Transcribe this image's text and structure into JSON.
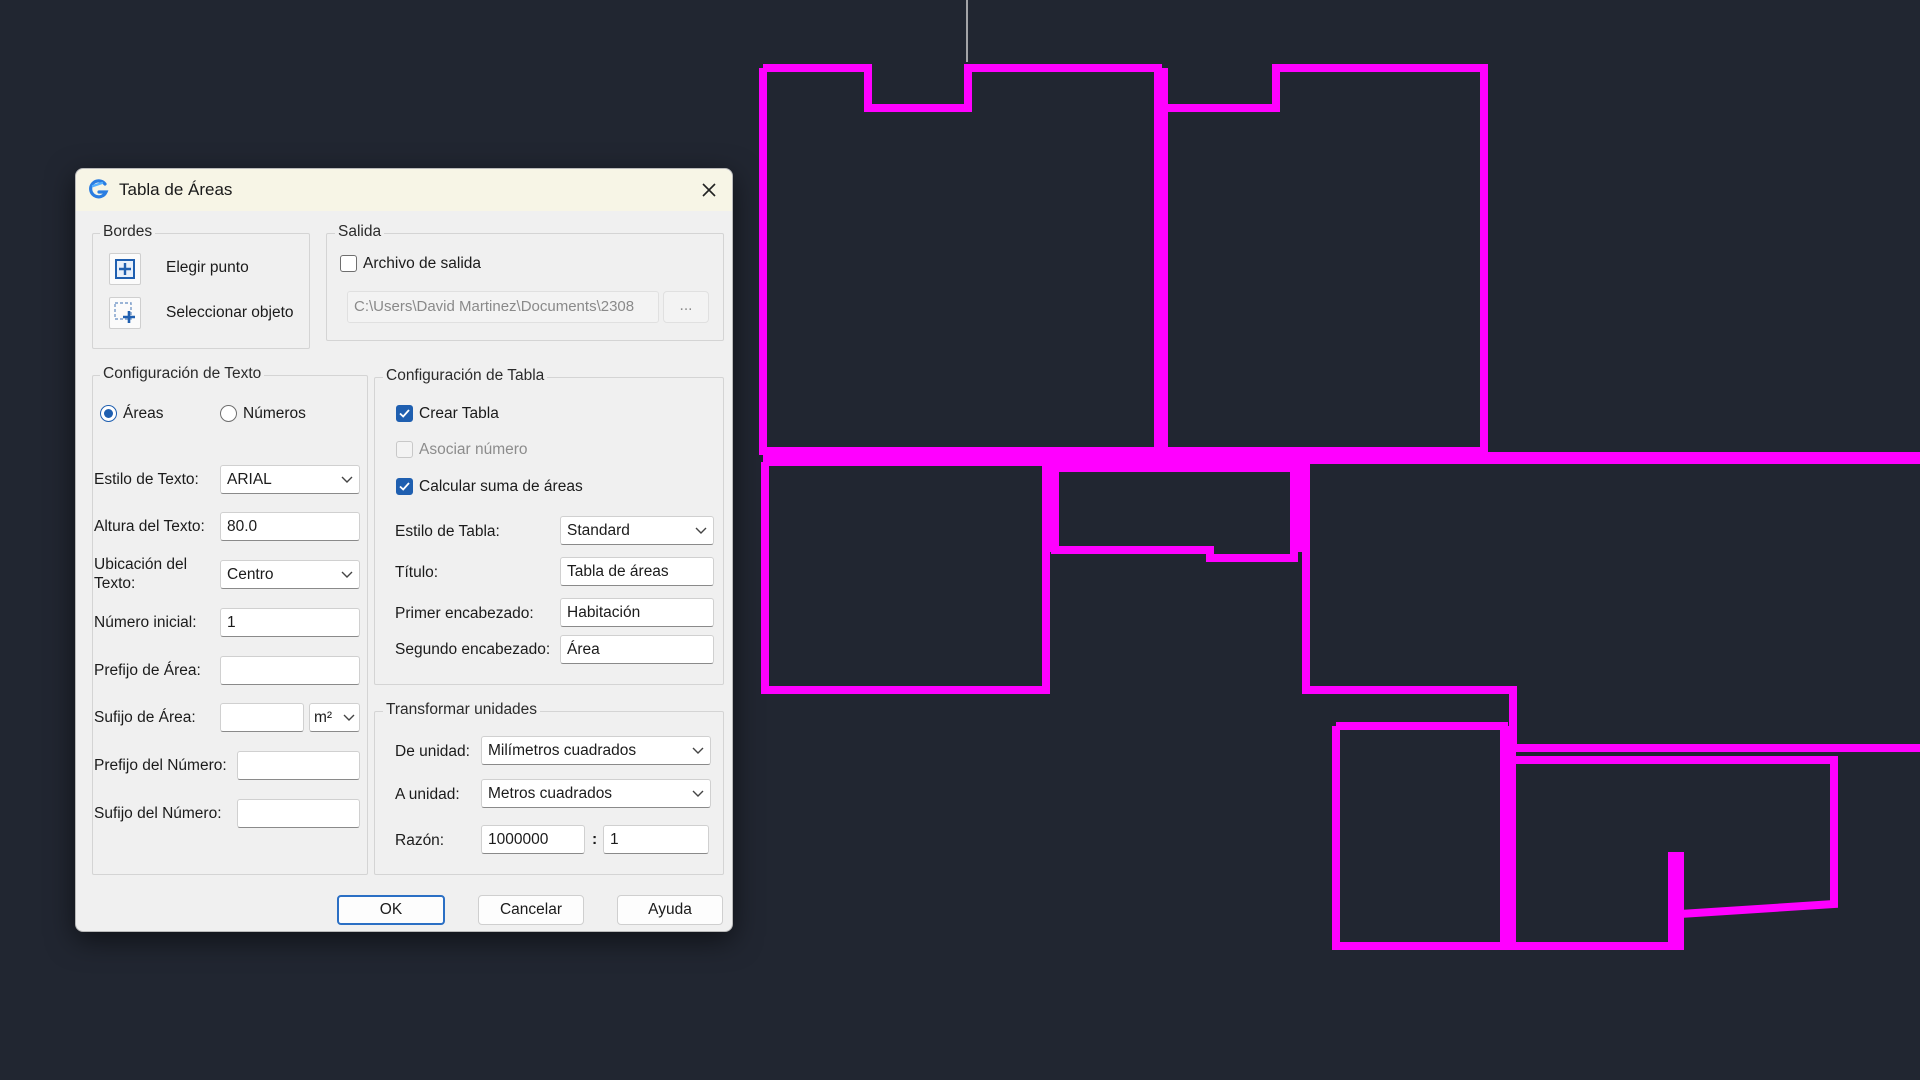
{
  "dialog": {
    "title": "Tabla de Áreas",
    "bordes": {
      "label": "Bordes",
      "pick_point": "Elegir punto",
      "select_object": "Seleccionar objeto"
    },
    "salida": {
      "label": "Salida",
      "output_file_label": "Archivo de salida",
      "output_file_checked": false,
      "path": "C:\\Users\\David Martinez\\Documents\\2308",
      "browse": "..."
    },
    "text_config": {
      "label": "Configuración de Texto",
      "radio_areas": "Áreas",
      "radio_numbers": "Números",
      "selected": "Áreas",
      "text_style_label": "Estilo de Texto:",
      "text_style_value": "ARIAL",
      "text_height_label": "Altura del Texto:",
      "text_height_value": "80.0",
      "text_location_label": "Ubicación del Texto:",
      "text_location_value": "Centro",
      "start_number_label": "Número inicial:",
      "start_number_value": "1",
      "area_prefix_label": "Prefijo de Área:",
      "area_prefix_value": "",
      "area_suffix_label": "Sufijo de Área:",
      "area_suffix_value": "",
      "area_suffix_unit": "m²",
      "number_prefix_label": "Prefijo del Número:",
      "number_prefix_value": "",
      "number_suffix_label": "Sufijo del Número:",
      "number_suffix_value": ""
    },
    "table_config": {
      "label": "Configuración de Tabla",
      "create_table": "Crear Tabla",
      "create_table_checked": true,
      "associate_number": "Asociar número",
      "associate_number_checked": false,
      "sum_areas": "Calcular suma de áreas",
      "sum_areas_checked": true,
      "table_style_label": "Estilo de Tabla:",
      "table_style_value": "Standard",
      "title_label": "Título:",
      "title_value": "Tabla de áreas",
      "first_header_label": "Primer encabezado:",
      "first_header_value": "Habitación",
      "second_header_label": "Segundo encabezado:",
      "second_header_value": "Área"
    },
    "units": {
      "label": "Transformar unidades",
      "from_label": "De unidad:",
      "from_value": "Milímetros cuadrados",
      "to_label": "A unidad:",
      "to_value": "Metros cuadrados",
      "ratio_label": "Razón:",
      "ratio_left": "1000000",
      "ratio_sep": ":",
      "ratio_right": "1"
    },
    "buttons": {
      "ok": "OK",
      "cancel": "Cancelar",
      "help": "Ayuda"
    }
  },
  "colors": {
    "canvas_bg": "#212631",
    "polyline": "#ff00ff",
    "accent": "#1f5fb0"
  },
  "icons": [
    "app-logo-icon",
    "close-icon",
    "pick-point-icon",
    "select-object-icon",
    "chevron-down-icon"
  ]
}
